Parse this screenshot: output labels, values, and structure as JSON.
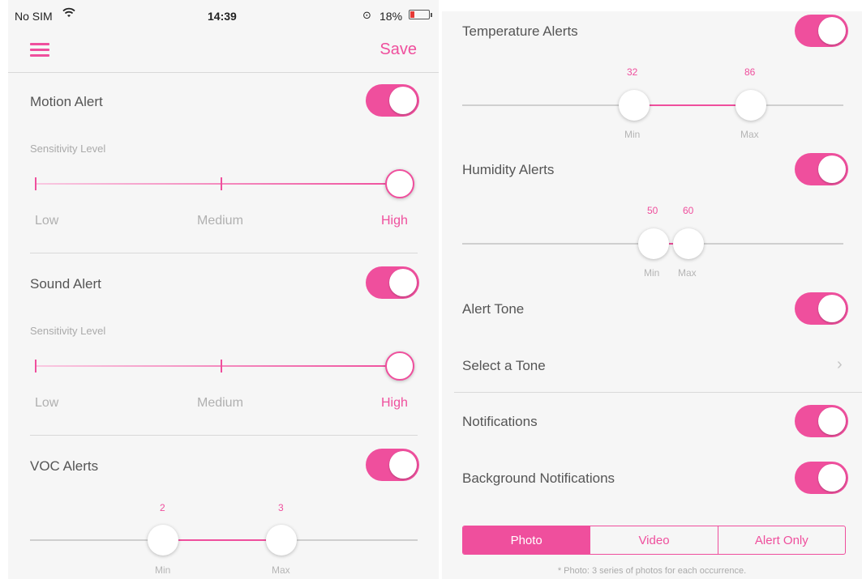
{
  "status_bar": {
    "carrier": "No SIM",
    "time": "14:39",
    "battery_pct": "18%"
  },
  "nav": {
    "save_label": "Save"
  },
  "motion": {
    "label": "Motion Alert",
    "sensitivity_label": "Sensitivity Level",
    "low": "Low",
    "medium": "Medium",
    "high": "High",
    "level": "High",
    "enabled": true
  },
  "sound": {
    "label": "Sound Alert",
    "sensitivity_label": "Sensitivity Level",
    "low": "Low",
    "medium": "Medium",
    "high": "High",
    "level": "High",
    "enabled": true
  },
  "voc": {
    "label": "VOC Alerts",
    "min_value": "2",
    "max_value": "3",
    "min_label": "Min",
    "max_label": "Max",
    "enabled": true
  },
  "temperature": {
    "label": "Temperature Alerts",
    "min_value": "32",
    "max_value": "86",
    "min_label": "Min",
    "max_label": "Max",
    "enabled": true
  },
  "humidity": {
    "label": "Humidity Alerts",
    "min_value": "50",
    "max_value": "60",
    "min_label": "Min",
    "max_label": "Max",
    "enabled": true
  },
  "alert_tone": {
    "label": "Alert Tone",
    "enabled": true
  },
  "select_tone": {
    "label": "Select a Tone"
  },
  "notifications": {
    "label": "Notifications",
    "enabled": true
  },
  "background_notifications": {
    "label": "Background Notifications",
    "enabled": true
  },
  "capture_mode": {
    "options": [
      "Photo",
      "Video",
      "Alert Only"
    ],
    "selected": "Photo"
  },
  "footnote": "* Photo: 3 series of photos for each occurrence.",
  "colors": {
    "accent": "#ef4f9d",
    "background": "#f6f6f6"
  }
}
